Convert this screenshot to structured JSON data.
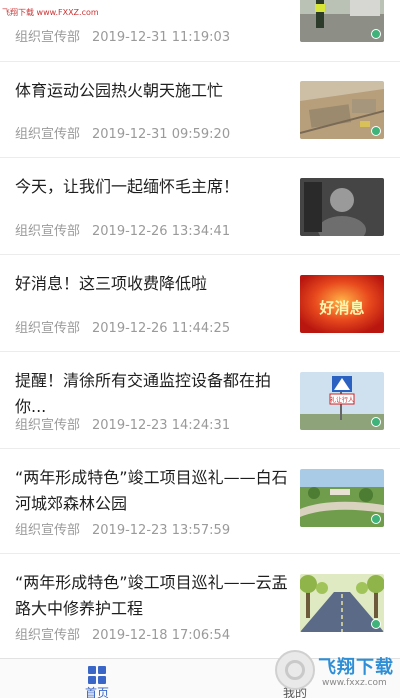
{
  "watermark": {
    "site_label": "飞翔下载",
    "site_url": "www.FXXZ.com",
    "brand": "飞翔下载",
    "brand_url": "www.fxxz.com"
  },
  "news": [
    {
      "title": "",
      "source": "组织宣传部",
      "time": "2019-12-31 11:19:03",
      "thumb": "police-traffic"
    },
    {
      "title": "体育运动公园热火朝天施工忙",
      "source": "组织宣传部",
      "time": "2019-12-31 09:59:20",
      "thumb": "construction-site"
    },
    {
      "title": "今天，让我们一起缅怀毛主席！",
      "source": "组织宣传部",
      "time": "2019-12-26 13:34:41",
      "thumb": "portrait"
    },
    {
      "title": "好消息！这三项收费降低啦",
      "source": "组织宣传部",
      "time": "2019-12-26 11:44:25",
      "thumb": "good-news"
    },
    {
      "title": "提醒！清徐所有交通监控设备都在拍你...",
      "source": "组织宣传部",
      "time": "2019-12-23 14:24:31",
      "thumb": "crosswalk-sign"
    },
    {
      "title": "“两年形成特色”竣工项目巡礼——白石河城郊森林公园",
      "source": "组织宣传部",
      "time": "2019-12-23 13:57:59",
      "thumb": "forest-park"
    },
    {
      "title": "“两年形成特色”竣工项目巡礼——云盂路大中修养护工程",
      "source": "组织宣传部",
      "time": "2019-12-18 17:06:54",
      "thumb": "tree-road"
    }
  ],
  "thumb_texts": {
    "good_news": "好消息",
    "sign": "礼让行人"
  },
  "tabs": [
    {
      "label": "首页",
      "icon": "grid-icon",
      "active": true
    },
    {
      "label": "我的",
      "icon": "person-icon",
      "active": false
    }
  ],
  "colors": {
    "accent": "#3a66c8",
    "meta": "#9a9a9a",
    "title": "#1e1e1e"
  }
}
